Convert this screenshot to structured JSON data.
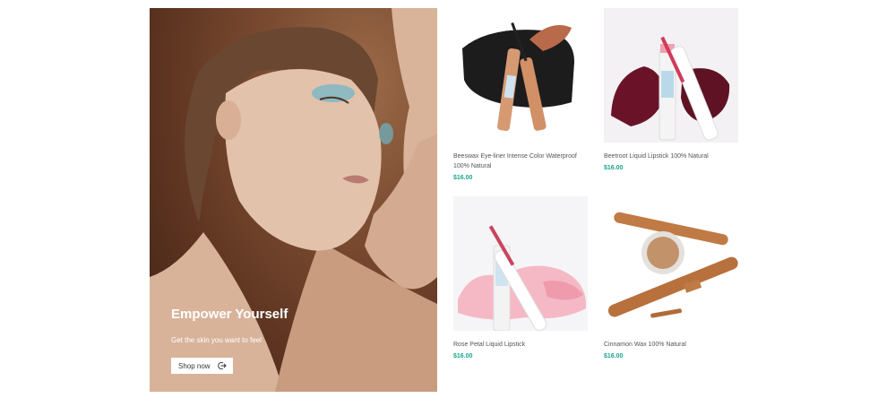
{
  "hero": {
    "title": "Empower Yourself",
    "subtitle": "Get the skin you want to feel",
    "button_label": "Shop now"
  },
  "products": [
    {
      "name": "Beeswax Eye-liner Intense Color Waterproof 100% Natural",
      "price": "$16.00"
    },
    {
      "name": "Beetroot Liquid Lipstick 100% Natural",
      "price": "$16.00"
    },
    {
      "name": "Rose Petal Liquid Lipstick",
      "price": "$16.00"
    },
    {
      "name": "Cinnamon Wax 100% Natural",
      "price": "$16.00"
    }
  ],
  "colors": {
    "price": "#1aa58c"
  }
}
